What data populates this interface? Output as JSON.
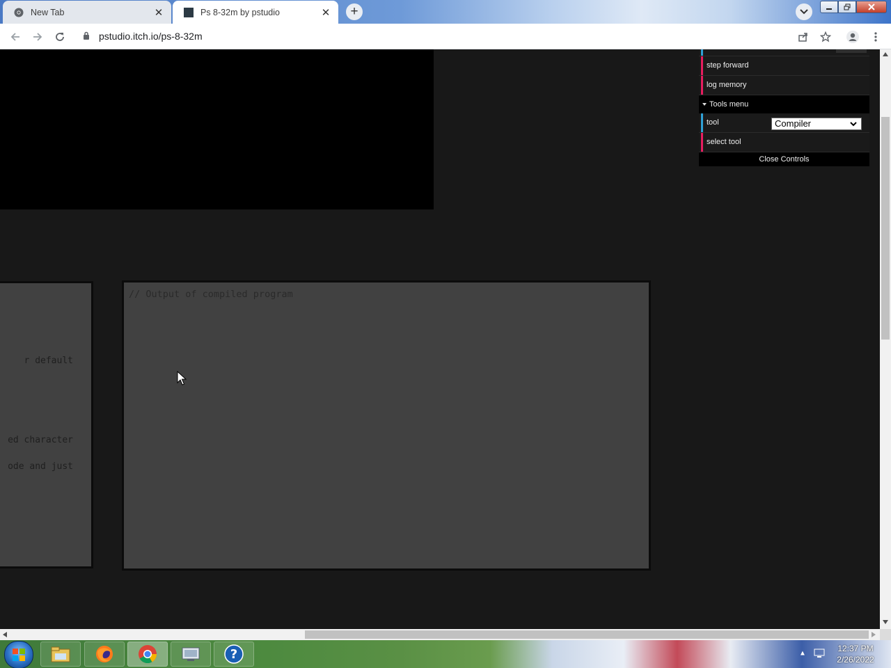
{
  "browser": {
    "tabs": [
      {
        "title": "New Tab",
        "active": false,
        "icon": "chrome-icon"
      },
      {
        "title": "Ps 8-32m by pstudio",
        "active": true,
        "icon": "page-favicon"
      }
    ],
    "new_tab_symbol": "+",
    "url": "pstudio.itch.io/ps-8-32m"
  },
  "editors": {
    "left_lines": [
      "r default",
      "ed character",
      "ode and just"
    ],
    "output_placeholder": "// Output of compiled program"
  },
  "controls": {
    "items": [
      {
        "label": "step forward",
        "color": "#e61d5f"
      },
      {
        "label": "log memory",
        "color": "#e61d5f"
      }
    ],
    "tools_folder": "Tools menu",
    "tool_label": "tool",
    "tool_value": "Compiler",
    "select_tool_label": "select tool",
    "close_label": "Close Controls",
    "accent_blue": "#2fa1d6"
  },
  "taskbar": {
    "time": "12:37 PM",
    "date": "2/26/2022",
    "apps": [
      "explorer-icon",
      "firefox-icon",
      "chrome-icon",
      "network-icon",
      "help-icon"
    ]
  }
}
